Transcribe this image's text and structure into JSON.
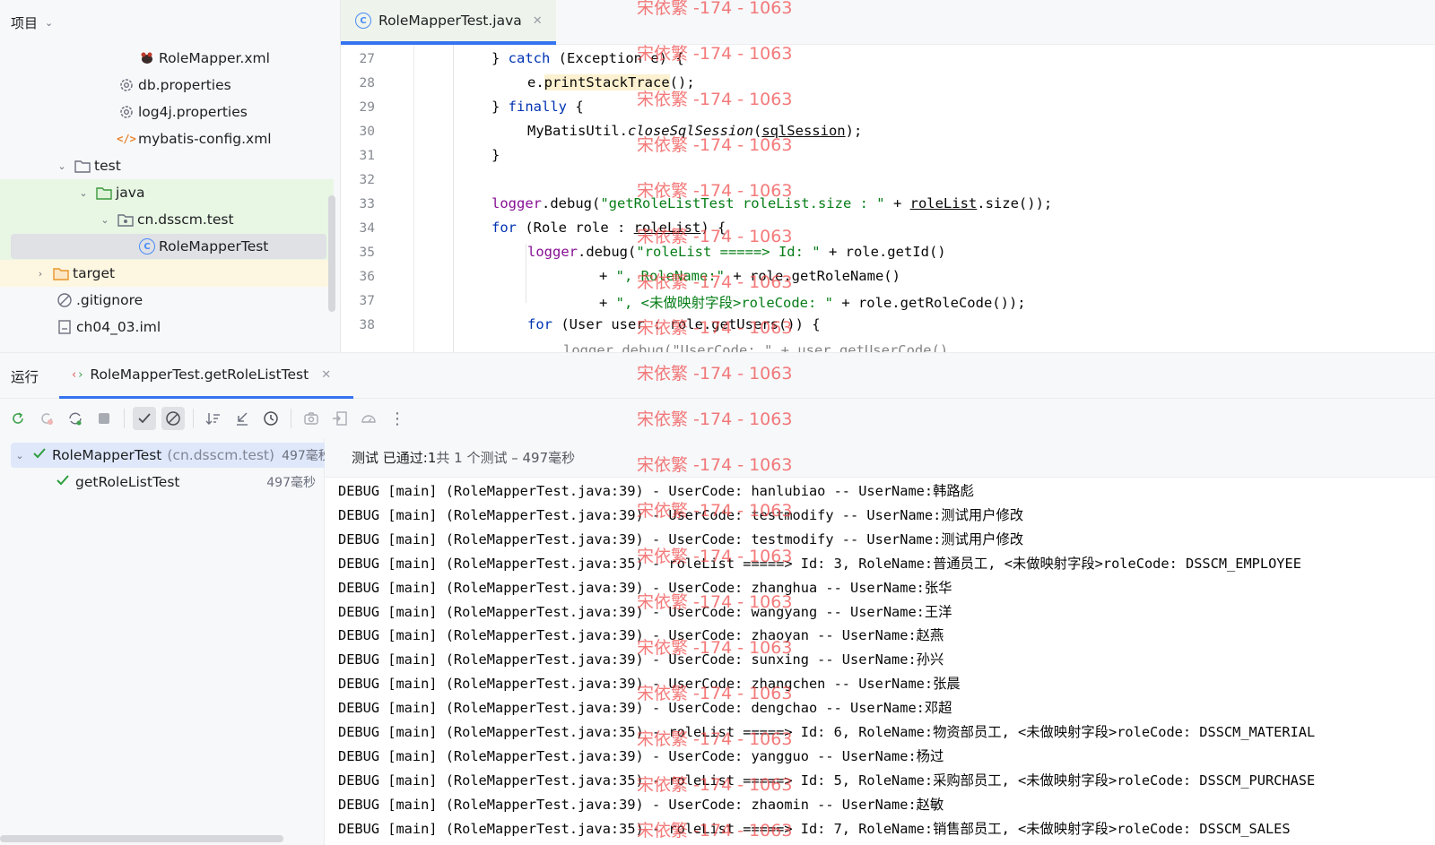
{
  "project": {
    "title": "项目",
    "items": [
      {
        "label": "RoleMapper.xml",
        "icon": "mybatis-icon"
      },
      {
        "label": "db.properties",
        "icon": "gear-icon"
      },
      {
        "label": "log4j.properties",
        "icon": "gear-icon"
      },
      {
        "label": "mybatis-config.xml",
        "icon": "xml-icon"
      },
      {
        "label": "test",
        "icon": "folder-icon"
      },
      {
        "label": "java",
        "icon": "folder-icon"
      },
      {
        "label": "cn.dsscm.test",
        "icon": "package-icon"
      },
      {
        "label": "RoleMapperTest",
        "icon": "class-icon"
      },
      {
        "label": "target",
        "icon": "folder-icon"
      },
      {
        "label": ".gitignore",
        "icon": "ignore-icon"
      },
      {
        "label": "ch04_03.iml",
        "icon": "module-file-icon"
      }
    ]
  },
  "editor": {
    "tab_label": "RoleMapperTest.java",
    "line_numbers": [
      "27",
      "28",
      "29",
      "30",
      "31",
      "32",
      "33",
      "34",
      "35",
      "36",
      "37",
      "38"
    ]
  },
  "run": {
    "title": "运行",
    "tab_label": "RoleMapperTest.getRoleListTest",
    "tree": {
      "root_label": "RoleMapperTest",
      "root_package": "(cn.dsscm.test)",
      "root_duration": "497毫秒",
      "child_label": "getRoleListTest",
      "child_duration": "497毫秒"
    },
    "status": {
      "prefix": "测试 已通过: ",
      "count": "1",
      "suffix": "共 1 个测试 – 497毫秒"
    },
    "console_lines": [
      "DEBUG [main] (RoleMapperTest.java:39) - UserCode: hanlubiao -- UserName:韩路彪",
      "DEBUG [main] (RoleMapperTest.java:39) - UserCode: testmodify -- UserName:测试用户修改",
      "DEBUG [main] (RoleMapperTest.java:39) - UserCode: testmodify -- UserName:测试用户修改",
      "DEBUG [main] (RoleMapperTest.java:35) - roleList =====> Id: 3, RoleName:普通员工, <未做映射字段>roleCode: DSSCM_EMPLOYEE",
      "DEBUG [main] (RoleMapperTest.java:39) - UserCode: zhanghua -- UserName:张华",
      "DEBUG [main] (RoleMapperTest.java:39) - UserCode: wangyang -- UserName:王洋",
      "DEBUG [main] (RoleMapperTest.java:39) - UserCode: zhaoyan -- UserName:赵燕",
      "DEBUG [main] (RoleMapperTest.java:39) - UserCode: sunxing -- UserName:孙兴",
      "DEBUG [main] (RoleMapperTest.java:39) - UserCode: zhangchen -- UserName:张晨",
      "DEBUG [main] (RoleMapperTest.java:39) - UserCode: dengchao -- UserName:邓超",
      "DEBUG [main] (RoleMapperTest.java:35) - roleList =====> Id: 6, RoleName:物资部员工, <未做映射字段>roleCode: DSSCM_MATERIAL",
      "DEBUG [main] (RoleMapperTest.java:39) - UserCode: yangguo -- UserName:杨过",
      "DEBUG [main] (RoleMapperTest.java:35) - roleList =====> Id: 5, RoleName:采购部员工, <未做映射字段>roleCode: DSSCM_PURCHASE",
      "DEBUG [main] (RoleMapperTest.java:39) - UserCode: zhaomin -- UserName:赵敏",
      "DEBUG [main] (RoleMapperTest.java:35) - roleList =====> Id: 7, RoleName:销售部员工, <未做映射字段>roleCode: DSSCM_SALES"
    ]
  },
  "watermark": "宋依繁 -174 - 1063",
  "colors": {
    "accent": "#3574f0",
    "pass": "#2e9e3f",
    "watermark": "#f04848"
  }
}
